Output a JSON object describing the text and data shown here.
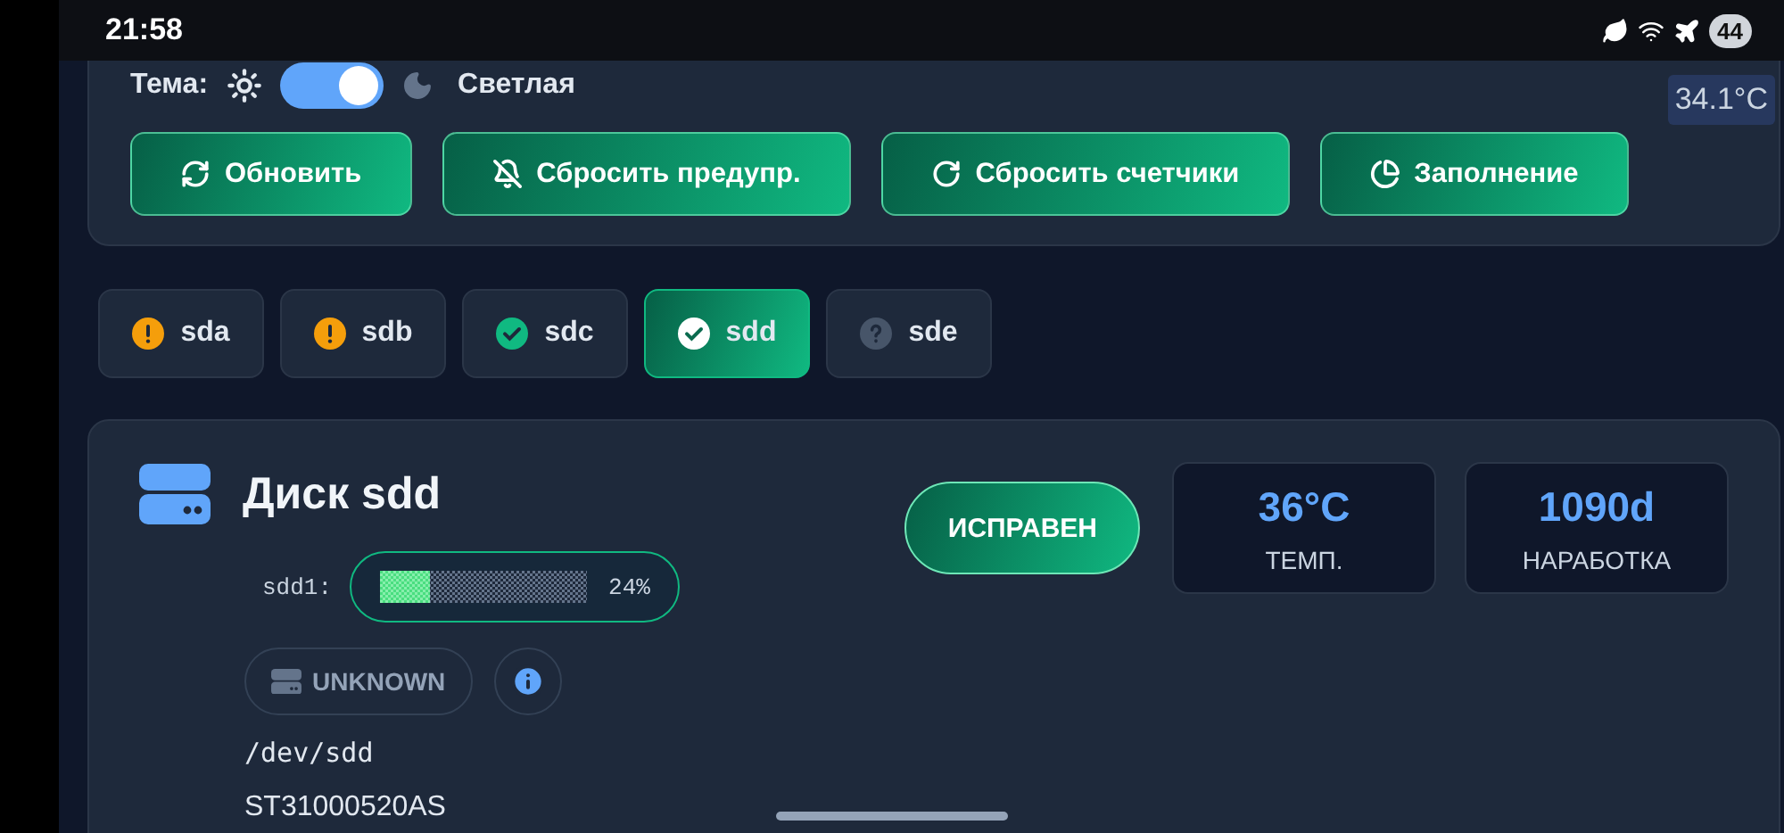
{
  "status_bar": {
    "time": "21:58",
    "battery": "44"
  },
  "theme": {
    "label": "Тема:",
    "toggle_on": true,
    "mode_label": "Светлая"
  },
  "temperature_badge": "34.1°C",
  "actions": [
    {
      "label": "Обновить",
      "kind": "refresh"
    },
    {
      "label": "Сбросить предупр.",
      "kind": "mute"
    },
    {
      "label": "Сбросить счетчики",
      "kind": "reset"
    },
    {
      "label": "Заполнение",
      "kind": "usage"
    }
  ],
  "disks": [
    {
      "name": "sda",
      "kind": "warning",
      "selected": false
    },
    {
      "name": "sdb",
      "kind": "warning",
      "selected": false
    },
    {
      "name": "sdc",
      "kind": "ok",
      "selected": false
    },
    {
      "name": "sdd",
      "kind": "ok",
      "selected": true
    },
    {
      "name": "sde",
      "kind": "unknown",
      "selected": false
    }
  ],
  "disk": {
    "title": "Диск sdd",
    "partitions": [
      {
        "name": "sdd1:",
        "level": 0.24,
        "reading": "24%"
      }
    ],
    "type_badge": "UNKNOWN",
    "device": "/dev/sdd",
    "model": "ST31000520AS",
    "health": "ИСПРАВЕН",
    "stats": [
      {
        "value": "36°C",
        "label": "ТЕМП."
      },
      {
        "value": "1090d",
        "label": "НАРАБОТКА"
      }
    ]
  }
}
